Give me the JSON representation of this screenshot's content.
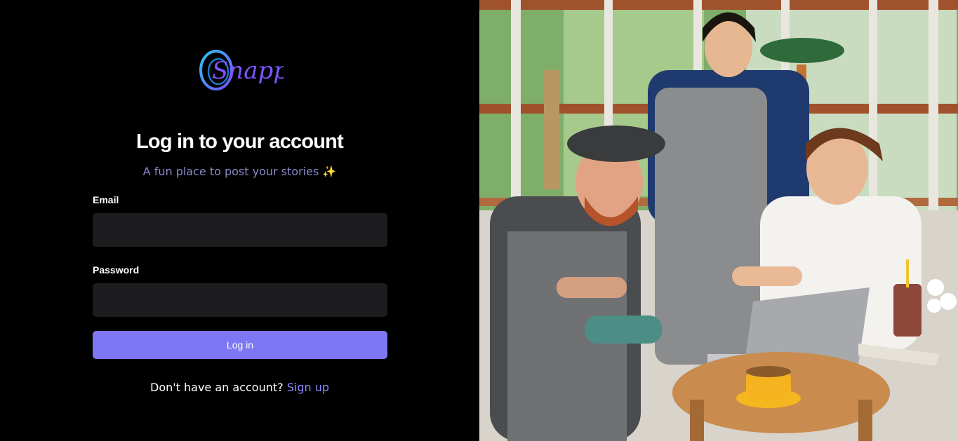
{
  "brand": {
    "logo_text": "Snappy"
  },
  "login": {
    "title": "Log in to your account",
    "subtitle": "A fun place to post your stories",
    "subtitle_emoji": "✨",
    "email_label": "Email",
    "email_value": "",
    "password_label": "Password",
    "password_value": "",
    "submit_label": "Log in",
    "signup_prompt": "Don't have an account?",
    "signup_link": "Sign up"
  },
  "colors": {
    "background": "#000000",
    "input_bg": "#1c1c1e",
    "accent": "#7d77f4",
    "link": "#8d87ff",
    "subtitle": "#8b88c9"
  },
  "hero_image": {
    "icon": "photo-people-at-cafe"
  }
}
